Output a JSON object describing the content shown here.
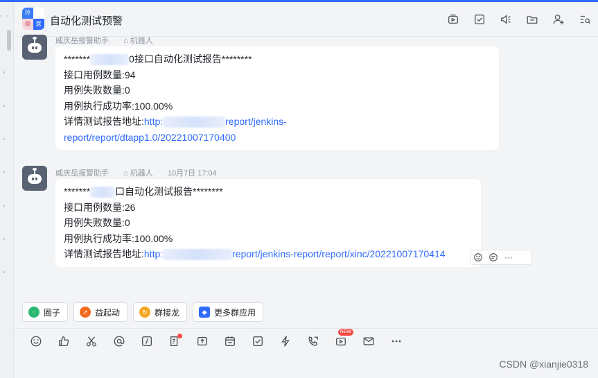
{
  "chat": {
    "title": "自动化测试预警",
    "avatar_letters": [
      "玲",
      "医"
    ]
  },
  "header_icons": [
    "video-meeting-icon",
    "tasks-icon",
    "announcement-icon",
    "folder-icon",
    "add-member-icon",
    "search-chat-icon"
  ],
  "messages": [
    {
      "sender": "威庆岳报警助手",
      "tag": "机器人",
      "time": "",
      "lines": [
        {
          "pre": "*******",
          "post": "0接口自动化测试报告********"
        },
        {
          "text": "接口用例数量:94"
        },
        {
          "text": "用例失败数量:0"
        },
        {
          "text": "用例执行成功率:100.00%"
        }
      ],
      "link_label": "详情测试报告地址:",
      "link_start": "http:",
      "link_tail": "report/jenkins-",
      "link_next": "report/report/dtapp1.0/20221007170400"
    },
    {
      "sender": "威庆岳报警助手",
      "tag": "机器人",
      "time": "10月7日 17:04",
      "lines": [
        {
          "pre": "*******",
          "post": "口自动化测试报告********"
        },
        {
          "text": "接口用例数量:26"
        },
        {
          "text": "用例失败数量:0"
        },
        {
          "text": "用例执行成功率:100.00%"
        }
      ],
      "link_label": "详情测试报告地址:",
      "link_start": "http:",
      "link_tail": "report/jenkins-report/report/xinc/20221007170414"
    }
  ],
  "hover_actions": [
    "reaction-icon",
    "reply-icon",
    "more-icon"
  ],
  "apps": [
    {
      "label": "圈子",
      "color": "#2bb673"
    },
    {
      "label": "益起动",
      "color": "#f26b1d"
    },
    {
      "label": "群接龙",
      "color": "#f5a623"
    },
    {
      "label": "更多群应用",
      "color": "#2f6bff"
    }
  ],
  "toolbar": [
    "emoji-icon",
    "thumbs-up-icon",
    "screenshot-icon",
    "mention-icon",
    "rich-text-icon",
    "doc-icon",
    "upload-icon",
    "calendar-icon",
    "task-icon",
    "quick-reply-icon",
    "phone-icon",
    "live-icon",
    "mail-icon",
    "more-icon"
  ],
  "toolbar_badge": "NEW",
  "watermark": "CSDN @xianjie0318",
  "left_dots": "⋮·"
}
